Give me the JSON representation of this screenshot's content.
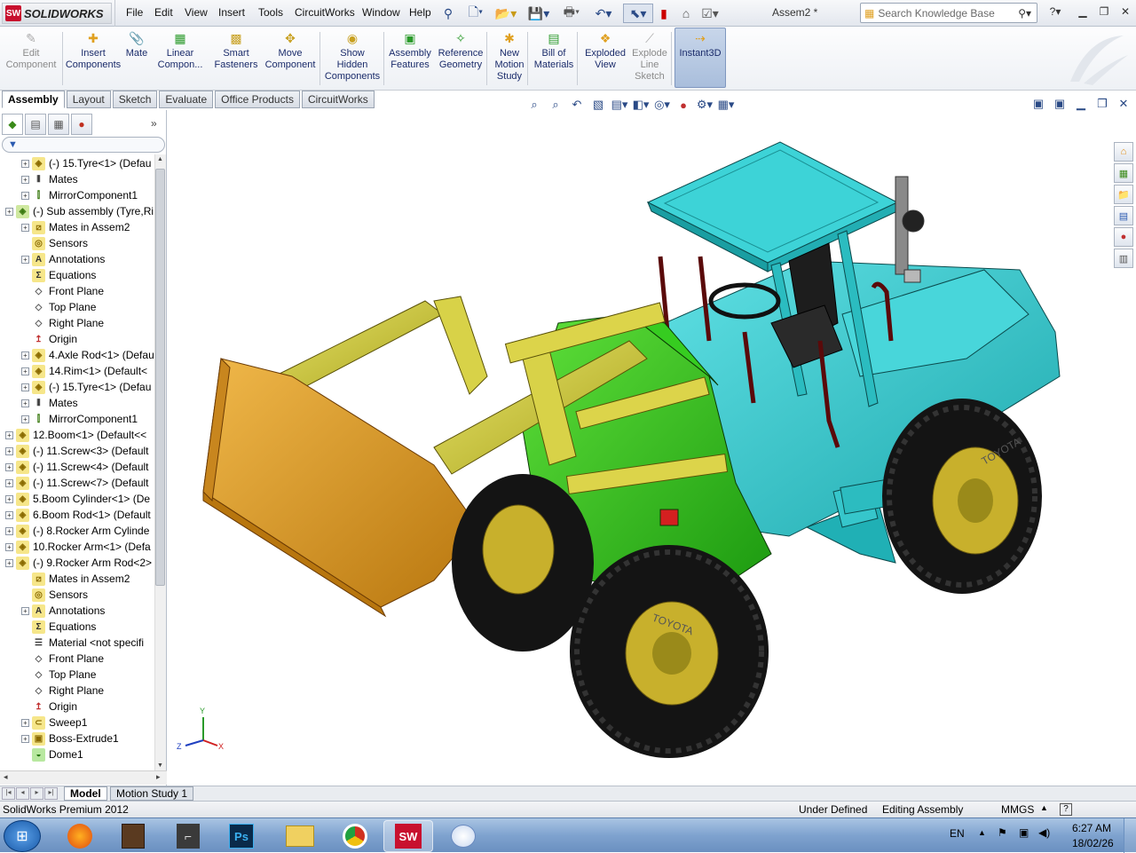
{
  "app": {
    "name": "SOLIDWORKS",
    "document_title": "Assem2 *"
  },
  "menu": [
    "File",
    "Edit",
    "View",
    "Insert",
    "Tools",
    "CircuitWorks",
    "Window",
    "Help"
  ],
  "search": {
    "placeholder": "Search Knowledge Base"
  },
  "toolbar": {
    "tools": [
      {
        "label": "Edit\nComponent",
        "icon": "edit-component-icon",
        "enabled": false
      },
      {
        "label": "Insert\nComponents",
        "icon": "insert-components-icon",
        "enabled": true
      },
      {
        "label": "Mate",
        "icon": "mate-icon",
        "enabled": true
      },
      {
        "label": "Linear\nCompon...",
        "icon": "linear-pattern-icon",
        "enabled": true
      },
      {
        "label": "Smart\nFasteners",
        "icon": "smart-fasteners-icon",
        "enabled": true
      },
      {
        "label": "Move\nComponent",
        "icon": "move-component-icon",
        "enabled": true
      },
      {
        "label": "Show\nHidden\nComponents",
        "icon": "show-hidden-icon",
        "enabled": true
      },
      {
        "label": "Assembly\nFeatures",
        "icon": "assembly-features-icon",
        "enabled": true
      },
      {
        "label": "Reference\nGeometry",
        "icon": "reference-geometry-icon",
        "enabled": true
      },
      {
        "label": "New\nMotion\nStudy",
        "icon": "motion-study-icon",
        "enabled": true
      },
      {
        "label": "Bill of\nMaterials",
        "icon": "bom-icon",
        "enabled": true
      },
      {
        "label": "Exploded\nView",
        "icon": "exploded-view-icon",
        "enabled": true
      },
      {
        "label": "Explode\nLine\nSketch",
        "icon": "explode-line-icon",
        "enabled": false
      },
      {
        "label": "Instant3D",
        "icon": "instant3d-icon",
        "enabled": true
      }
    ]
  },
  "tabs": [
    "Assembly",
    "Layout",
    "Sketch",
    "Evaluate",
    "Office Products",
    "CircuitWorks"
  ],
  "active_tab": "Assembly",
  "tree": [
    {
      "label": "(-) 15.Tyre<1> (Defau",
      "indent": 1,
      "icon": "part",
      "expand": true
    },
    {
      "label": "Mates",
      "indent": 1,
      "icon": "mates",
      "expand": true
    },
    {
      "label": "MirrorComponent1",
      "indent": 1,
      "icon": "mirror",
      "expand": true
    },
    {
      "label": "(-) Sub assembly (Tyre,Ri",
      "indent": 0,
      "icon": "assembly",
      "expand": true
    },
    {
      "label": "Mates in Assem2",
      "indent": 1,
      "icon": "matesin",
      "expand": true
    },
    {
      "label": "Sensors",
      "indent": 1,
      "icon": "sensor",
      "expand": false
    },
    {
      "label": "Annotations",
      "indent": 1,
      "icon": "annot",
      "expand": true
    },
    {
      "label": "Equations",
      "indent": 1,
      "icon": "eq",
      "expand": false
    },
    {
      "label": "Front Plane",
      "indent": 1,
      "icon": "plane",
      "expand": false
    },
    {
      "label": "Top Plane",
      "indent": 1,
      "icon": "plane",
      "expand": false
    },
    {
      "label": "Right Plane",
      "indent": 1,
      "icon": "plane",
      "expand": false
    },
    {
      "label": "Origin",
      "indent": 1,
      "icon": "origin",
      "expand": false
    },
    {
      "label": "4.Axle Rod<1> (Defau",
      "indent": 1,
      "icon": "part",
      "expand": true
    },
    {
      "label": "14.Rim<1> (Default<",
      "indent": 1,
      "icon": "part",
      "expand": true
    },
    {
      "label": "(-) 15.Tyre<1> (Defau",
      "indent": 1,
      "icon": "part",
      "expand": true
    },
    {
      "label": "Mates",
      "indent": 1,
      "icon": "mates",
      "expand": true
    },
    {
      "label": "MirrorComponent1",
      "indent": 1,
      "icon": "mirror",
      "expand": true
    },
    {
      "label": "12.Boom<1> (Default<<",
      "indent": 0,
      "icon": "part",
      "expand": true
    },
    {
      "label": "(-) 11.Screw<3> (Default",
      "indent": 0,
      "icon": "part",
      "expand": true
    },
    {
      "label": "(-) 11.Screw<4> (Default",
      "indent": 0,
      "icon": "part",
      "expand": true
    },
    {
      "label": "(-) 11.Screw<7> (Default",
      "indent": 0,
      "icon": "part",
      "expand": true
    },
    {
      "label": "5.Boom Cylinder<1> (De",
      "indent": 0,
      "icon": "part",
      "expand": true
    },
    {
      "label": "6.Boom Rod<1> (Default",
      "indent": 0,
      "icon": "part",
      "expand": true
    },
    {
      "label": "(-) 8.Rocker Arm Cylinde",
      "indent": 0,
      "icon": "part",
      "expand": true
    },
    {
      "label": "10.Rocker Arm<1> (Defa",
      "indent": 0,
      "icon": "part",
      "expand": true
    },
    {
      "label": "(-) 9.Rocker Arm Rod<2>",
      "indent": 0,
      "icon": "part",
      "expand": true
    },
    {
      "label": "Mates in Assem2",
      "indent": 1,
      "icon": "matesin",
      "expand": false
    },
    {
      "label": "Sensors",
      "indent": 1,
      "icon": "sensor",
      "expand": false
    },
    {
      "label": "Annotations",
      "indent": 1,
      "icon": "annot",
      "expand": true
    },
    {
      "label": "Equations",
      "indent": 1,
      "icon": "eq",
      "expand": false
    },
    {
      "label": "Material <not specifi",
      "indent": 1,
      "icon": "material",
      "expand": false
    },
    {
      "label": "Front Plane",
      "indent": 1,
      "icon": "plane",
      "expand": false
    },
    {
      "label": "Top Plane",
      "indent": 1,
      "icon": "plane",
      "expand": false
    },
    {
      "label": "Right Plane",
      "indent": 1,
      "icon": "plane",
      "expand": false
    },
    {
      "label": "Origin",
      "indent": 1,
      "icon": "origin",
      "expand": false
    },
    {
      "label": "Sweep1",
      "indent": 1,
      "icon": "sweep",
      "expand": true
    },
    {
      "label": "Boss-Extrude1",
      "indent": 1,
      "icon": "extrude",
      "expand": true
    },
    {
      "label": "Dome1",
      "indent": 1,
      "icon": "dome",
      "expand": false
    }
  ],
  "bottom_tabs": [
    "Model",
    "Motion Study 1"
  ],
  "status": {
    "product": "SolidWorks Premium 2012",
    "state": "Under Defined",
    "mode": "Editing Assembly",
    "units": "MMGS"
  },
  "taskbar": {
    "lang": "EN",
    "time": "6:27 AM",
    "date": "18/02/26"
  },
  "triad": {
    "x": "X",
    "y": "Y",
    "z": "Z"
  },
  "tyre_brand": "TOYOTA",
  "colors": {
    "cab": "#2fc0c4",
    "frame": "#2ec21a",
    "boom": "#c8c23a",
    "bucket": "#d1921e",
    "rim": "#c8b02c",
    "tyre": "#141414",
    "rail": "#8a1a1a"
  }
}
